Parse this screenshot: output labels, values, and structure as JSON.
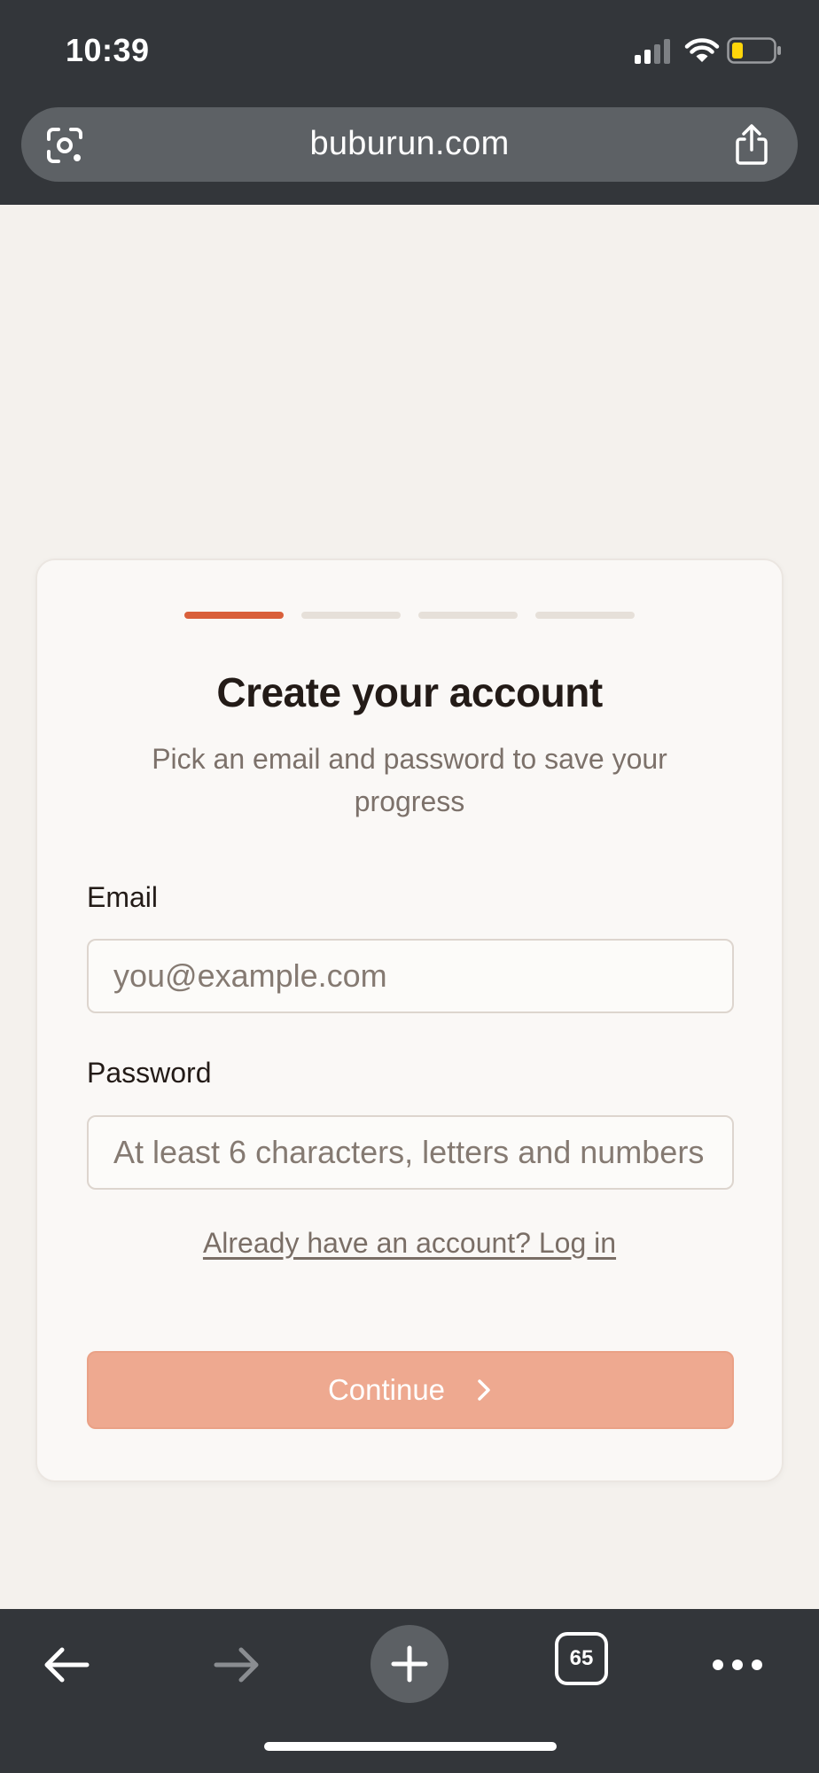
{
  "status_bar": {
    "time": "10:39"
  },
  "browser": {
    "url": "buburun.com",
    "tab_count": "65"
  },
  "signup": {
    "steps_total": 4,
    "steps_current": 1,
    "title": "Create your account",
    "subtitle": "Pick an email and password to save your progress",
    "email_label": "Email",
    "email_placeholder": "you@example.com",
    "email_value": "",
    "password_label": "Password",
    "password_placeholder": "At least 6 characters, letters and numbers",
    "password_value": "",
    "login_link": "Already have an account? Log in",
    "continue_label": "Continue"
  },
  "icons": {
    "lens": "google-lens-icon",
    "share": "share-icon",
    "back": "back-arrow-icon",
    "forward": "forward-arrow-icon",
    "new_tab": "plus-icon",
    "more": "more-dots-icon",
    "continue": "chevron-right-icon"
  },
  "colors": {
    "accent": "#d9603b",
    "button_disabled": "#eea990",
    "chrome": "#33363a",
    "battery_fill": "#ffd60a"
  }
}
